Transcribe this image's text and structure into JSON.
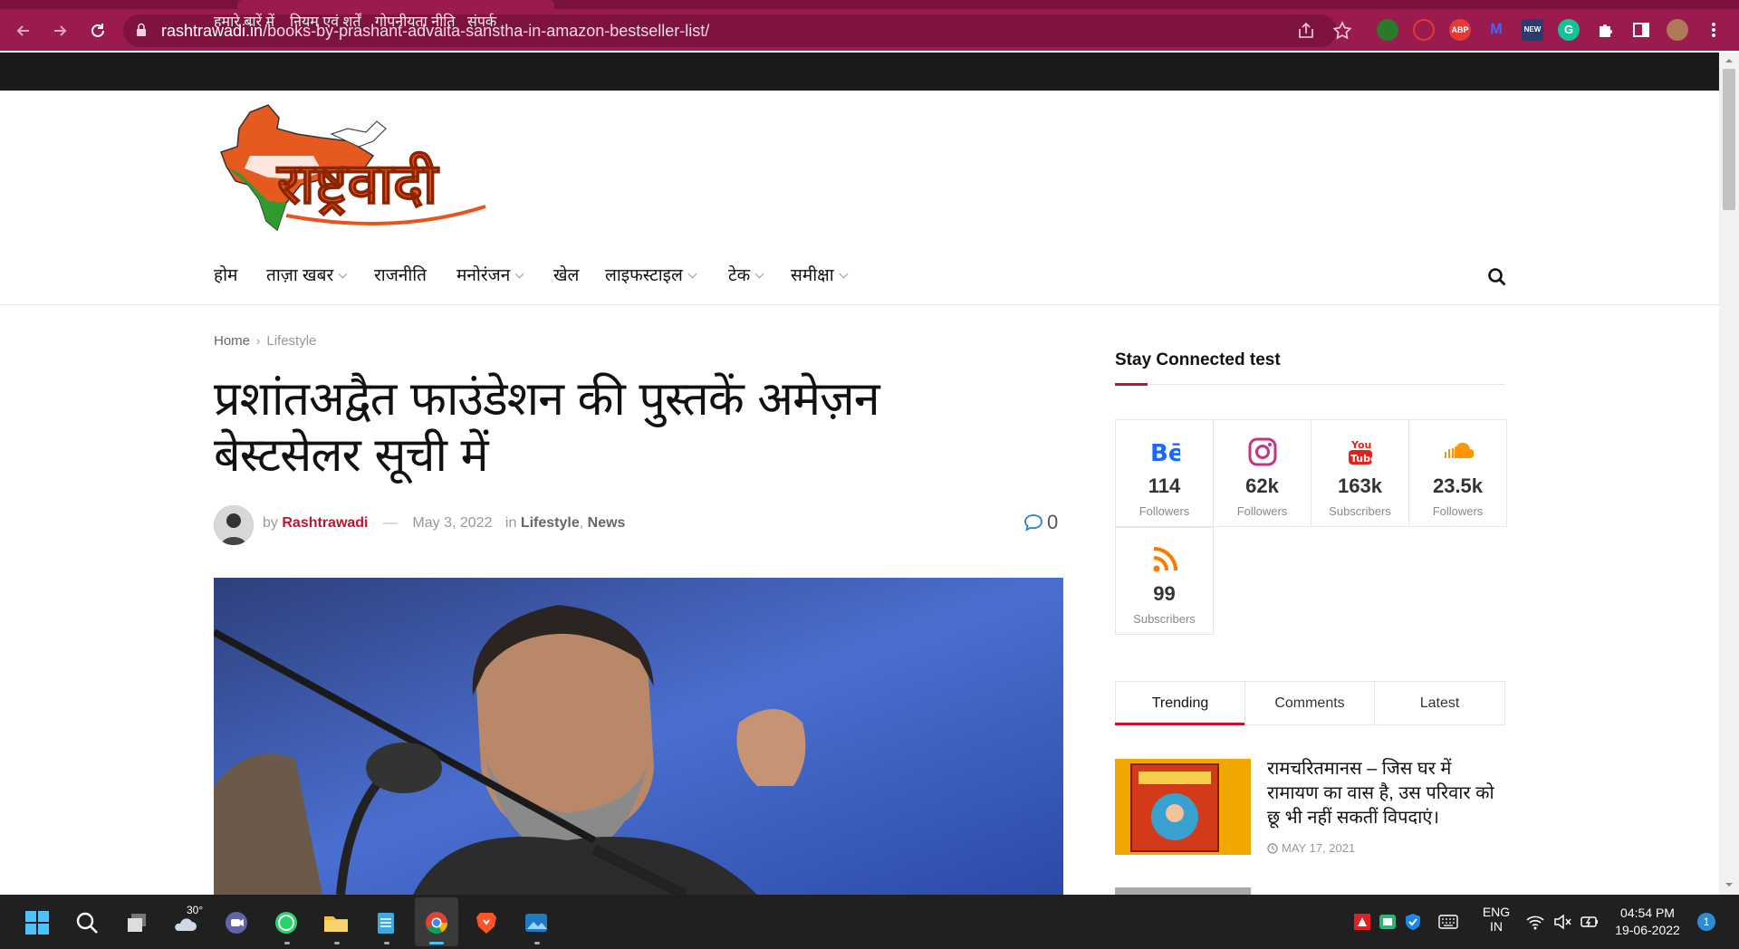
{
  "browser": {
    "url_host": "rashtrawadi.in",
    "url_path": "/books-by-prashant-advaita-sanstha-in-amazon-bestseller-list/",
    "extensions": [
      "map-extension-icon",
      "blocker-extension-icon",
      "abp-icon",
      "malwarebytes-icon",
      "new-extension-icon",
      "grammarly-icon",
      "puzzle-icon",
      "sidepanel-icon"
    ]
  },
  "topbar": {
    "links": [
      "हमारे बारें में",
      "नियम एवं शर्तें",
      "गोपनीयता नीति",
      "संपर्क"
    ]
  },
  "logo": {
    "text": "राष्ट्रवादी"
  },
  "nav": {
    "items": [
      {
        "label": "होम",
        "dropdown": false
      },
      {
        "label": "ताज़ा खबर",
        "dropdown": true
      },
      {
        "label": "राजनीति",
        "dropdown": false
      },
      {
        "label": "मनोरंजन",
        "dropdown": true
      },
      {
        "label": "खेल",
        "dropdown": false
      },
      {
        "label": "लाइफस्टाइल",
        "dropdown": true
      },
      {
        "label": "टेक",
        "dropdown": true
      },
      {
        "label": "समीक्षा",
        "dropdown": true
      }
    ]
  },
  "breadcrumb": {
    "home": "Home",
    "separator": "›",
    "current": "Lifestyle"
  },
  "article": {
    "title": "प्रशांतअद्वैत फाउंडेशन की पुस्तकें अमेज़न बेस्टसेलर सूची में",
    "by": "by",
    "author": "Rashtrawadi",
    "dash": "—",
    "date": "May 3, 2022",
    "in": "in",
    "category1": "Lifestyle",
    "comma": ",",
    "category2": "News",
    "comments": "0"
  },
  "sidebar": {
    "title": "Stay Connected test",
    "social": [
      {
        "icon": "behance-icon",
        "count": "114",
        "label": "Followers",
        "color": "#1769ff"
      },
      {
        "icon": "instagram-icon",
        "count": "62k",
        "label": "Followers",
        "color": "#c13584"
      },
      {
        "icon": "youtube-icon",
        "count": "163k",
        "label": "Subscribers",
        "color": "#e62117"
      },
      {
        "icon": "soundcloud-icon",
        "count": "23.5k",
        "label": "Followers",
        "color": "#ff9500"
      },
      {
        "icon": "rss-icon",
        "count": "99",
        "label": "Subscribers",
        "color": "#f57d00"
      }
    ],
    "tabs": [
      "Trending",
      "Comments",
      "Latest"
    ],
    "trending": [
      {
        "title": "रामचरितमानस – जिस घर में रामायण का वास है, उस परिवार को छू भी नहीं सकतीं विपदाएं।",
        "date": "MAY 17, 2021"
      }
    ]
  },
  "taskbar": {
    "weather": "30°",
    "lang_line1": "ENG",
    "lang_line2": "IN",
    "time": "04:54 PM",
    "date": "19-06-2022",
    "notifications": "1"
  },
  "colors": {
    "chrome": "#9b1b4e",
    "accent": "#c4122f",
    "topbar": "#1b1b1b"
  }
}
